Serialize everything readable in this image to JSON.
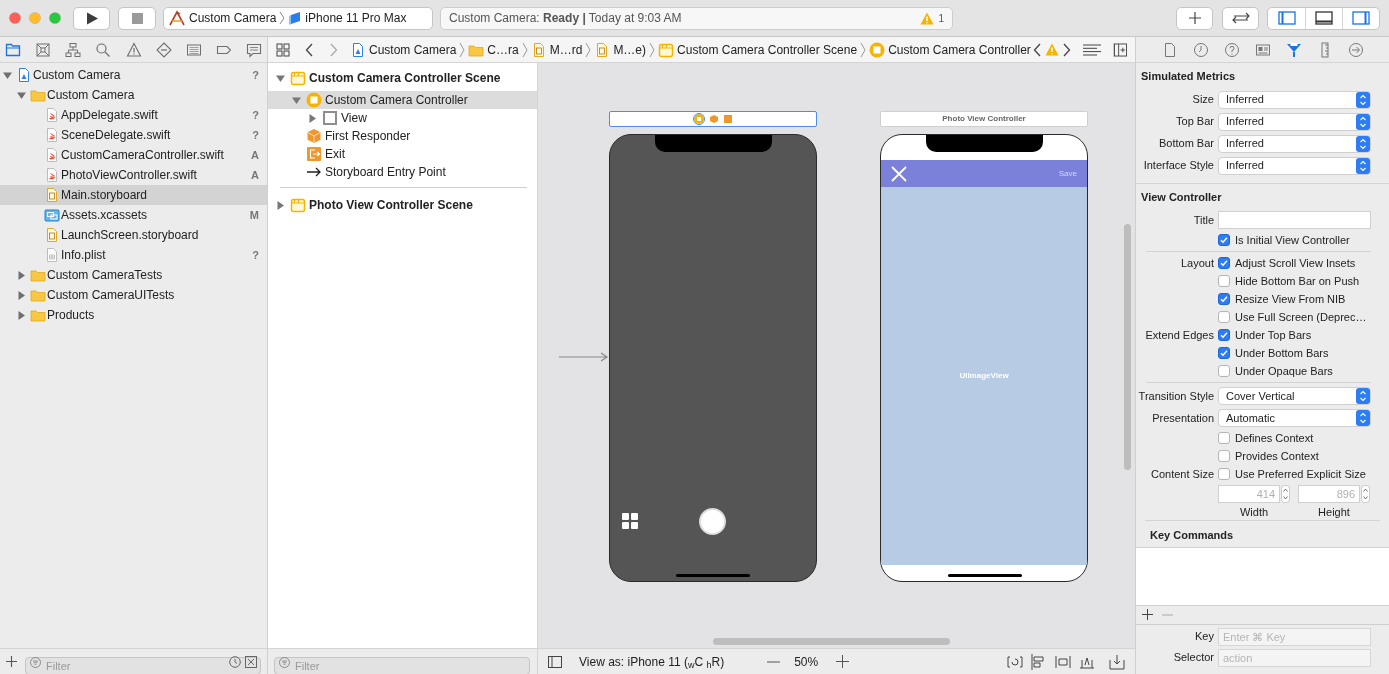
{
  "toolbar": {
    "scheme": "Custom Camera",
    "device": "iPhone 11 Pro Max",
    "status": "Custom Camera: **Ready |** Today at 9:03 AM",
    "warning_count": "1",
    "panel_toggles": [
      {
        "kind": "left",
        "on": true
      },
      {
        "kind": "bottom",
        "on": false
      },
      {
        "kind": "right",
        "on": true
      }
    ]
  },
  "navigator_tabs": [
    {
      "kind": "project",
      "selected": true
    },
    {
      "kind": "source_control",
      "selected": false
    },
    {
      "kind": "symbols",
      "selected": false
    },
    {
      "kind": "find",
      "selected": false
    },
    {
      "kind": "issues",
      "selected": false
    },
    {
      "kind": "tests",
      "selected": false
    },
    {
      "kind": "debug",
      "selected": false
    },
    {
      "kind": "breakpoints",
      "selected": false
    },
    {
      "kind": "reports",
      "selected": false
    }
  ],
  "navigator": [
    {
      "label": "Custom Camera",
      "kind": "project",
      "badge": "?",
      "expanded": true,
      "selected": false,
      "children": [
        {
          "label": "Custom Camera",
          "kind": "folder",
          "expanded": true,
          "selected": false,
          "children": [
            {
              "label": "AppDelegate.swift",
              "kind": "swift",
              "badge": "?",
              "selected": false
            },
            {
              "label": "SceneDelegate.swift",
              "kind": "swift",
              "badge": "?",
              "selected": false
            },
            {
              "label": "CustomCameraController.swift",
              "kind": "swift",
              "badge": "A",
              "selected": false
            },
            {
              "label": "PhotoViewController.swift",
              "kind": "swift",
              "badge": "A",
              "selected": false
            },
            {
              "label": "Main.storyboard",
              "kind": "storyboard",
              "selected": true
            },
            {
              "label": "Assets.xcassets",
              "kind": "assets",
              "badge": "M",
              "selected": false
            },
            {
              "label": "LaunchScreen.storyboard",
              "kind": "storyboard",
              "selected": false
            },
            {
              "label": "Info.plist",
              "kind": "plist",
              "badge": "?",
              "selected": false
            }
          ]
        },
        {
          "label": "Custom CameraTests",
          "kind": "folder",
          "expanded": false,
          "selected": false
        },
        {
          "label": "Custom CameraUITests",
          "kind": "folder",
          "expanded": false,
          "selected": false
        },
        {
          "label": "Products",
          "kind": "folder",
          "expanded": false,
          "selected": false
        }
      ]
    }
  ],
  "navigator_filter": {
    "placeholder": "Filter"
  },
  "jump_bar": [
    {
      "kind": "project",
      "label": "Custom Camera"
    },
    {
      "kind": "folder",
      "label": "C…ra"
    },
    {
      "kind": "storyboard",
      "label": "M…rd"
    },
    {
      "kind": "storyboard",
      "label": "M…e)"
    },
    {
      "kind": "scene",
      "label": "Custom Camera Controller Scene"
    },
    {
      "kind": "controller",
      "label": "Custom Camera Controller"
    }
  ],
  "outline": [
    {
      "label": "Custom Camera Controller Scene",
      "kind": "scene",
      "expanded": true,
      "selected": false,
      "children": [
        {
          "label": "Custom Camera Controller",
          "kind": "controller",
          "expanded": true,
          "selected": true,
          "children": [
            {
              "label": "View",
              "kind": "view",
              "expanded": false,
              "selected": false
            }
          ]
        },
        {
          "label": "First Responder",
          "kind": "responder",
          "selected": false
        },
        {
          "label": "Exit",
          "kind": "exit",
          "selected": false
        },
        {
          "label": "Storyboard Entry Point",
          "kind": "entry",
          "selected": false
        }
      ]
    },
    {
      "label": "Photo View Controller Scene",
      "kind": "scene",
      "expanded": false,
      "selected": false
    }
  ],
  "outline_filter": {
    "placeholder": "Filter"
  },
  "canvas": {
    "scenes": [
      {
        "kind": "camera",
        "selected": true
      },
      {
        "kind": "photo",
        "title": "Photo View Controller",
        "nav_button": "Save",
        "image_label": "UIImageView",
        "selected": false
      }
    ],
    "view_as": "View as: iPhone 11 ($_{w}$C $_{h}$R)",
    "zoom": "50%"
  },
  "inspector_tabs": [
    {
      "kind": "file",
      "selected": false
    },
    {
      "kind": "history",
      "selected": false
    },
    {
      "kind": "help",
      "selected": false
    },
    {
      "kind": "identity",
      "selected": false
    },
    {
      "kind": "attributes",
      "selected": true
    },
    {
      "kind": "size",
      "selected": false
    },
    {
      "kind": "connections",
      "selected": false
    }
  ],
  "inspector": [
    {
      "title": "Simulated Metrics",
      "rows": [
        {
          "kind": "popup",
          "label": "Size",
          "value": "Inferred"
        },
        {
          "kind": "popup",
          "label": "Top Bar",
          "value": "Inferred"
        },
        {
          "kind": "popup",
          "label": "Bottom Bar",
          "value": "Inferred"
        },
        {
          "kind": "popup",
          "label": "Interface Style",
          "value": "Inferred"
        }
      ]
    },
    {
      "title": "View Controller",
      "rows": [
        {
          "kind": "text",
          "label": "Title"
        },
        {
          "kind": "check",
          "text": "Is Initial View Controller",
          "checked": true
        },
        {
          "kind": "divider"
        },
        {
          "kind": "check",
          "label": "Layout",
          "text": "Adjust Scroll View Insets",
          "checked": true
        },
        {
          "kind": "check",
          "text": "Hide Bottom Bar on Push",
          "checked": false
        },
        {
          "kind": "check",
          "text": "Resize View From NIB",
          "checked": true
        },
        {
          "kind": "check",
          "text": "Use Full Screen (Deprec…",
          "checked": false
        },
        {
          "kind": "check",
          "label": "Extend Edges",
          "text": "Under Top Bars",
          "checked": true
        },
        {
          "kind": "check",
          "text": "Under Bottom Bars",
          "checked": true
        },
        {
          "kind": "check",
          "text": "Under Opaque Bars",
          "checked": false
        },
        {
          "kind": "divider"
        },
        {
          "kind": "popup",
          "label": "Transition Style",
          "value": "Cover Vertical"
        },
        {
          "kind": "popup",
          "label": "Presentation",
          "value": "Automatic"
        },
        {
          "kind": "check",
          "text": "Defines Context",
          "checked": false
        },
        {
          "kind": "check",
          "text": "Provides Context",
          "checked": false
        },
        {
          "kind": "check",
          "label": "Content Size",
          "text": "Use Preferred Explicit Size",
          "checked": false
        },
        {
          "kind": "size",
          "disabled": true,
          "fields": [
            {
              "value": "414",
              "caption": "Width"
            },
            {
              "value": "896",
              "caption": "Height"
            }
          ]
        }
      ]
    }
  ],
  "key_commands": {
    "title": "Key Commands",
    "fields": [
      {
        "label": "Key",
        "placeholder": "Enter ⌘ Key"
      },
      {
        "label": "Selector",
        "placeholder": "action"
      }
    ]
  }
}
